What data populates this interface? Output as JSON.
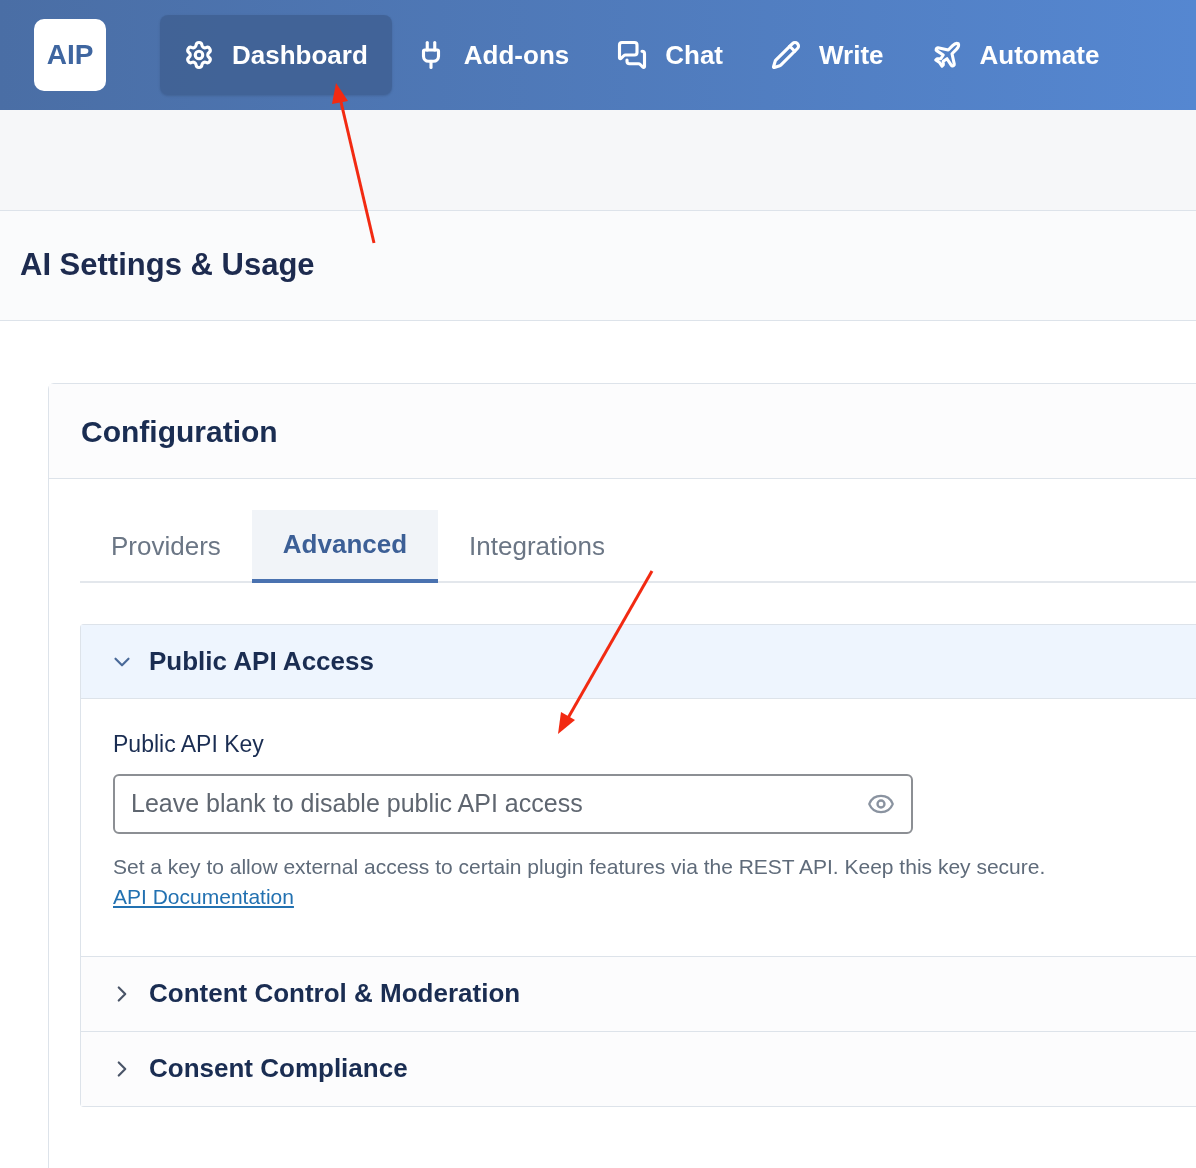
{
  "nav": {
    "logo": "AIP",
    "items": [
      {
        "kind": "gear",
        "label": "Dashboard",
        "selected": true
      },
      {
        "kind": "plug",
        "label": "Add-ons",
        "selected": false
      },
      {
        "kind": "chat",
        "label": "Chat",
        "selected": false
      },
      {
        "kind": "pencil",
        "label": "Write",
        "selected": false
      },
      {
        "kind": "plane",
        "label": "Automate",
        "selected": false
      }
    ]
  },
  "page_title": "AI Settings & Usage",
  "card": {
    "title": "Configuration",
    "tabs": [
      {
        "label": "Providers",
        "selected": false
      },
      {
        "label": "Advanced",
        "selected": true
      },
      {
        "label": "Integrations",
        "selected": false
      }
    ],
    "sections": [
      {
        "title": "Public API Access",
        "expanded": true,
        "field": {
          "label": "Public API Key",
          "placeholder": "Leave blank to disable public API access",
          "help": "Set a key to allow external access to certain plugin features via the REST API. Keep this key secure.",
          "link": "API Documentation"
        }
      },
      {
        "title": "Content Control & Moderation",
        "expanded": false
      },
      {
        "title": "Consent Compliance",
        "expanded": false
      }
    ]
  }
}
